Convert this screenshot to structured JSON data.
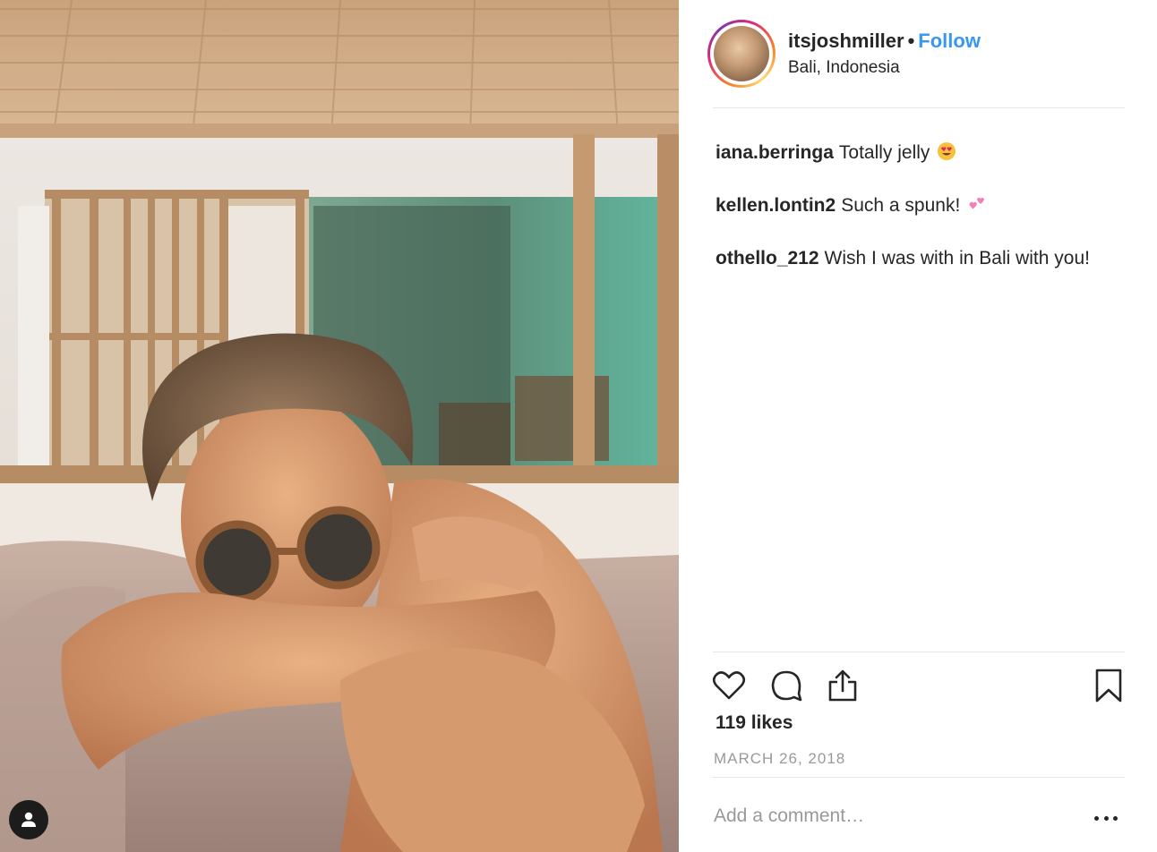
{
  "post": {
    "username": "itsjoshmiller",
    "separator": "•",
    "follow_label": "Follow",
    "location": "Bali, Indonesia"
  },
  "comments": [
    {
      "user": "iana.berringa",
      "text": "Totally jelly",
      "emoji": "heart-eyes-emoji"
    },
    {
      "user": "kellen.lontin2",
      "text": "Such a spunk!",
      "emoji": "two-hearts-emoji"
    },
    {
      "user": "othello_212",
      "text": "Wish I was with in Bali with you!"
    }
  ],
  "likes": "119 likes",
  "date": "MARCH 26, 2018",
  "add_comment_placeholder": "Add a comment…",
  "icons": {
    "like": "heart-icon",
    "comment": "speech-bubble-icon",
    "share": "share-icon",
    "save": "bookmark-icon",
    "more": "ellipsis-icon",
    "tagged_users": "user-icon"
  },
  "colors": {
    "link_blue": "#3897f0",
    "text": "#262626",
    "muted": "#999999",
    "divider": "#e6e6e6"
  }
}
